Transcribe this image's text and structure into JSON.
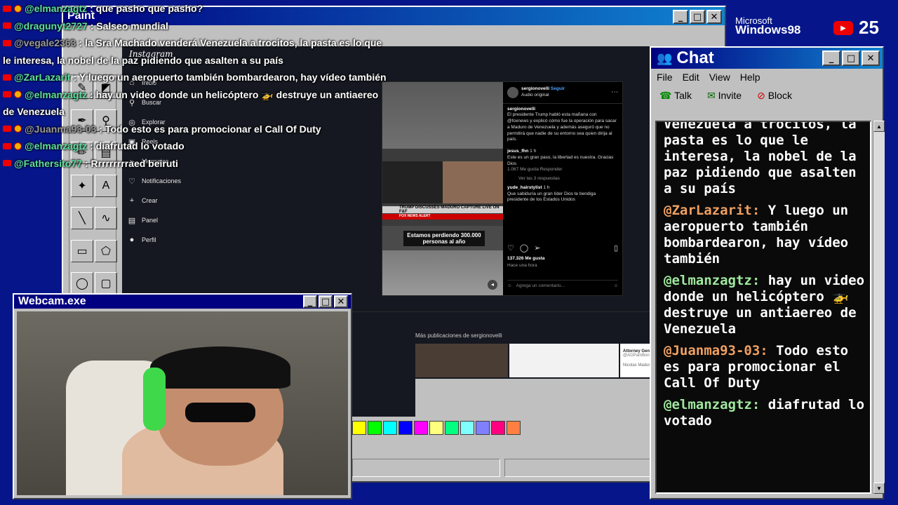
{
  "paint": {
    "title": "Paint",
    "tools": [
      "✎",
      "◩",
      "✒",
      "⚲",
      "✏",
      "▤",
      "✦",
      "A",
      "╲",
      "∿",
      "▭",
      "⬠",
      "◯",
      "▢"
    ],
    "palette": [
      "#ffff00",
      "#00ff00",
      "#00ffff",
      "#0000ff",
      "#ff00ff",
      "#ffff80",
      "#00ff80",
      "#80ffff",
      "#8080ff",
      "#ff0080",
      "#ff8040"
    ]
  },
  "instagram": {
    "logo": "Instagram",
    "nav": [
      {
        "icon": "⌂",
        "label": "Inicio"
      },
      {
        "icon": "⚲",
        "label": "Buscar"
      },
      {
        "icon": "◎",
        "label": "Explorar"
      },
      {
        "icon": "▣",
        "label": "Reels"
      },
      {
        "icon": "➢",
        "label": "Mensajes"
      },
      {
        "icon": "♡",
        "label": "Notificaciones"
      },
      {
        "icon": "+",
        "label": "Crear"
      },
      {
        "icon": "▤",
        "label": "Panel"
      },
      {
        "icon": "●",
        "label": "Perfil"
      }
    ],
    "post": {
      "user": "sergionovelli",
      "follow": "Seguir",
      "audio": "Audio original",
      "caption_user": "sergionovelli",
      "caption": "El presidente Trump habló esta mañana con @foxnews y explicó cómo fue la operación para sacar a Maduro de Venezuela y además aseguró que no permitirá que nadie de su entorno sea quien dirija al país.",
      "comment1_user": "jesus_fhn",
      "comment1_time": "1 h",
      "comment1": "Este es un gran paso, la libertad es nuestra. Gracias Dios",
      "comment1_meta": "1.067 Me gusta   Responder",
      "replies": "Ver las 3 respuestas",
      "comment2_user": "yude_hairstylist",
      "comment2_time": "1 h",
      "comment2": "Que sabiduría un gran líder Dios te bendiga presidente de los Estados Unidos",
      "likes": "137.326 Me gusta",
      "time": "Hace una hora",
      "add_comment": "Agrega un comentario...",
      "breaking": "BREAKING NEWS",
      "headline": "TRUMP DISCUSSES MADURO CAPTURE LIVE ON F&F",
      "fox_alert": "FOX NEWS ALERT",
      "video_caption": "Estamos perdiendo 300.000 personas al año"
    },
    "more_from": "Más publicaciones de sergionovelli",
    "related_title": "Attorney General Pamela B.",
    "related_handle": "@AGPamBondi",
    "related_text": "Nicolas Maduro and his wife, Cilia Flores,"
  },
  "webcam": {
    "title": "Webcam.exe"
  },
  "chat": {
    "title": "Chat",
    "menu": [
      "File",
      "Edit",
      "View",
      "Help"
    ],
    "toolbar": [
      "Talk",
      "Invite",
      "Block"
    ],
    "messages": [
      {
        "user": "",
        "text": "Venezuela a trocitos, la pasta es lo que le interesa, la nobel de la paz pidiendo que asalten a su país"
      },
      {
        "user": "@ZarLazarit:",
        "text": "Y luego un aeropuerto también bombardearon, hay vídeo también"
      },
      {
        "user": "@elmanzagtz:",
        "text": "hay un video donde un helicóptero 🚁 destruye un antiaereo de Venezuela"
      },
      {
        "user": "@Juanma93-03:",
        "text": "Todo esto es para promocionar el Call Of Duty"
      },
      {
        "user": "@elmanzagtz:",
        "text": "diafrutad lo votado"
      }
    ]
  },
  "overlay": [
    {
      "user": "@elmanzagtz",
      "text": ": que pasho que pasho?",
      "badge": "yt-star"
    },
    {
      "user": "@dragunyt2727",
      "text": ": Salseo mundial",
      "badge": "yt"
    },
    {
      "user": "@vegale2363",
      "text": ": la Sra Machado venderá Venezuela a trocitos, la pasta es lo que",
      "badge": "yt",
      "gray": true
    },
    {
      "user": "",
      "text": "le interesa, la nobel de la paz pidiendo que asalten a su país",
      "badge": ""
    },
    {
      "user": "@ZarLazarit",
      "text": ": Y luego un aeropuerto también bombardearon, hay vídeo también",
      "badge": "yt"
    },
    {
      "user": "@elmanzagtz",
      "text": ": hay un video donde un helicóptero 🚁 destruye un antiaereo",
      "badge": "yt-star"
    },
    {
      "user": "",
      "text": "de Venezuela",
      "badge": ""
    },
    {
      "user": "@Juanma93-03",
      "text": ": Todo esto es para promocionar el Call Of Duty",
      "badge": "yt-star",
      "gray": true
    },
    {
      "user": "@elmanzagtz",
      "text": ": diafrutad lo votado",
      "badge": "yt-star"
    },
    {
      "user": "@Fathersito77",
      "text": ": Rrrrrrrrraed beiruti",
      "badge": "yt"
    }
  ],
  "branding": {
    "ms": "Microsoft",
    "win": "Windows98",
    "count": "25"
  },
  "colors": {
    "desktop": "#06168a",
    "titlebar": "#000080",
    "user": "#5ee0a0",
    "chat_user": "#f0a060"
  }
}
